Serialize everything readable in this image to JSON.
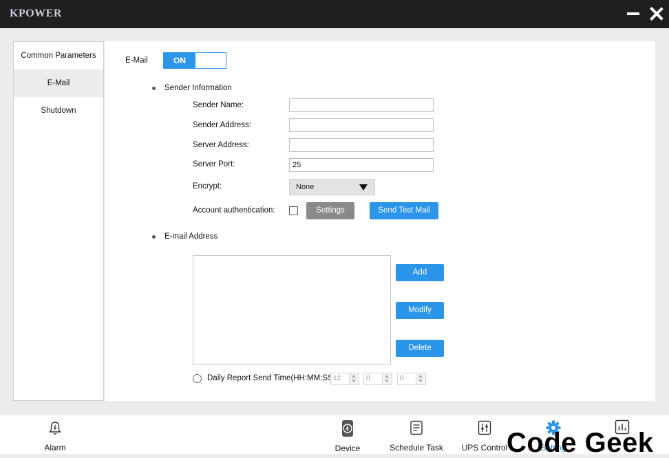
{
  "app": {
    "title": "KPOWER"
  },
  "sidebar": {
    "items": [
      {
        "label": "Common Parameters",
        "active": false
      },
      {
        "label": "E-Mail",
        "active": true
      },
      {
        "label": "Shutdown",
        "active": false
      }
    ]
  },
  "email": {
    "label": "E-Mail",
    "toggle": {
      "state_label": "ON",
      "enabled": true
    },
    "sender_section": {
      "heading": "Sender Information",
      "sender_name": {
        "label": "Sender Name:",
        "value": ""
      },
      "sender_address": {
        "label": "Sender Address:",
        "value": ""
      },
      "server_address": {
        "label": "Server Address:",
        "value": ""
      },
      "server_port": {
        "label": "Server Port:",
        "value": "25"
      },
      "encrypt": {
        "label": "Encrypt:",
        "value": "None"
      },
      "account_auth": {
        "label": "Account authentication:",
        "checked": false
      },
      "settings_button": "Settings",
      "send_test_button": "Send Test Mail"
    },
    "address_section": {
      "heading": "E-mail Address",
      "addresses": [],
      "add_button": "Add",
      "modify_button": "Modify",
      "delete_button": "Delete"
    },
    "daily_report": {
      "label": "Daily Report Send Time(HH:MM:SS):",
      "selected": false,
      "hours": "12",
      "minutes": "0",
      "seconds": "0"
    }
  },
  "bottom_nav": {
    "tabs": [
      {
        "label": "Alarm",
        "icon": "alarm-bell-icon",
        "active": false
      },
      {
        "label": "Device",
        "icon": "device-icon",
        "active": false
      },
      {
        "label": "Schedule Task",
        "icon": "schedule-task-icon",
        "active": false
      },
      {
        "label": "UPS Control",
        "icon": "ups-control-icon",
        "active": false
      },
      {
        "label": "Setting",
        "icon": "gear-icon",
        "active": true
      },
      {
        "label": "",
        "icon": "statistics-icon",
        "active": false
      }
    ]
  },
  "watermark": {
    "text": "Code Geek"
  },
  "colors": {
    "accent": "#2b95e9",
    "titlebar": "#1f1f1f",
    "gray_button": "#8a8a8a"
  }
}
